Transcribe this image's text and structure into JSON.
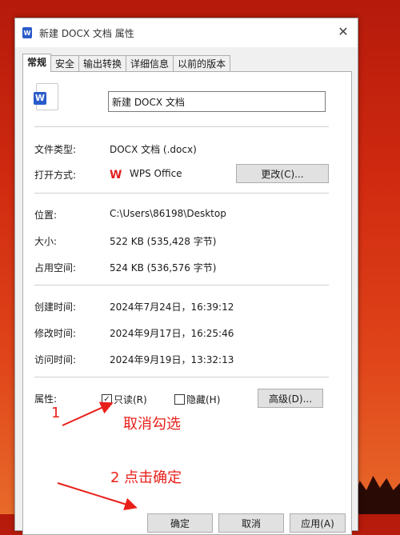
{
  "window": {
    "title": "新建 DOCX 文档 属性",
    "close_icon": "✕"
  },
  "tabs": [
    {
      "label": "常规",
      "active": true
    },
    {
      "label": "安全"
    },
    {
      "label": "输出转换"
    },
    {
      "label": "详细信息"
    },
    {
      "label": "以前的版本"
    }
  ],
  "file": {
    "name": "新建 DOCX 文档",
    "icon_letter": "W"
  },
  "info": {
    "type_label": "文件类型:",
    "type_value": "DOCX 文档 (.docx)",
    "open_label": "打开方式:",
    "open_value": "WPS Office",
    "change_button": "更改(C)...",
    "location_label": "位置:",
    "location_value": "C:\\Users\\86198\\Desktop",
    "size_label": "大小:",
    "size_value": "522 KB (535,428 字节)",
    "disk_label": "占用空间:",
    "disk_value": "524 KB (536,576 字节)",
    "created_label": "创建时间:",
    "created_value": "2024年7月24日，16:39:12",
    "modified_label": "修改时间:",
    "modified_value": "2024年9月17日，16:25:46",
    "accessed_label": "访问时间:",
    "accessed_value": "2024年9月19日，13:32:13"
  },
  "attributes": {
    "label": "属性:",
    "readonly_label": "只读(R)",
    "readonly_checked": true,
    "hidden_label": "隐藏(H)",
    "hidden_checked": false,
    "advanced_button": "高级(D)..."
  },
  "footer": {
    "ok": "确定",
    "cancel": "取消",
    "apply": "应用(A)"
  },
  "annotations": {
    "num1": "1",
    "text1": "取消勾选",
    "text2": "2  点击确定",
    "color": "#e8201a"
  }
}
